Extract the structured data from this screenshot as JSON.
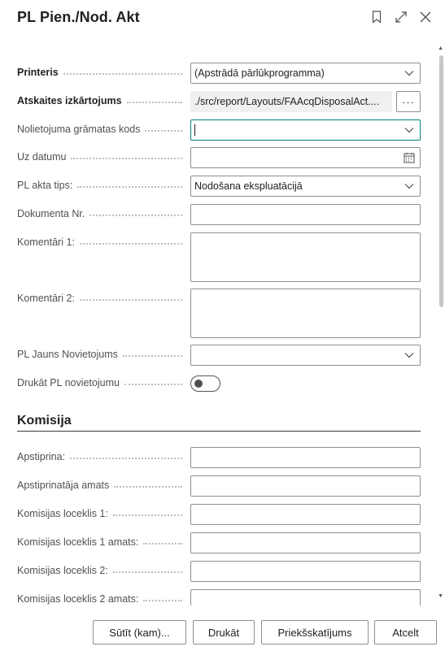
{
  "header": {
    "title": "PL Pien./Nod. Akt",
    "icons": [
      "bookmark-icon",
      "expand-icon",
      "close-icon"
    ]
  },
  "form": {
    "printer": {
      "label": "Printeris",
      "value": "(Apstrādā pārlūkprogramma)"
    },
    "layout": {
      "label": "Atskaites izkārtojums",
      "value": "./src/report/Layouts/FAAcqDisposalAct....",
      "button": "···"
    },
    "depr_book": {
      "label": "Nolietojuma grāmatas kods",
      "value": ""
    },
    "to_date": {
      "label": "Uz datumu",
      "value": ""
    },
    "act_type": {
      "label": "PL akta tips:",
      "value": "Nodošana ekspluatācijā"
    },
    "doc_no": {
      "label": "Dokumenta Nr.",
      "value": ""
    },
    "comment1": {
      "label": "Komentāri 1:",
      "value": ""
    },
    "comment2": {
      "label": "Komentāri 2:",
      "value": ""
    },
    "new_location": {
      "label": "PL Jauns Novietojums",
      "value": ""
    },
    "print_location": {
      "label": "Drukāt PL novietojumu",
      "checked": false
    }
  },
  "commission": {
    "title": "Komisija",
    "fields": [
      {
        "label": "Apstiprina:",
        "value": ""
      },
      {
        "label": "Apstiprinatāja amats",
        "value": ""
      },
      {
        "label": "Komisijas loceklis 1:",
        "value": ""
      },
      {
        "label": "Komisijas loceklis 1 amats:",
        "value": ""
      },
      {
        "label": "Komisijas loceklis 2:",
        "value": ""
      },
      {
        "label": "Komisijas loceklis 2 amats:",
        "value": ""
      }
    ]
  },
  "footer": {
    "send_label": "Sūtīt (kam)...",
    "print_label": "Drukāt",
    "preview_label": "Priekšskatījums",
    "cancel_label": "Atcelt"
  },
  "colors": {
    "focus": "#00857a",
    "border": "#8f8f8f",
    "readonly_bg": "#f0f0f0"
  }
}
